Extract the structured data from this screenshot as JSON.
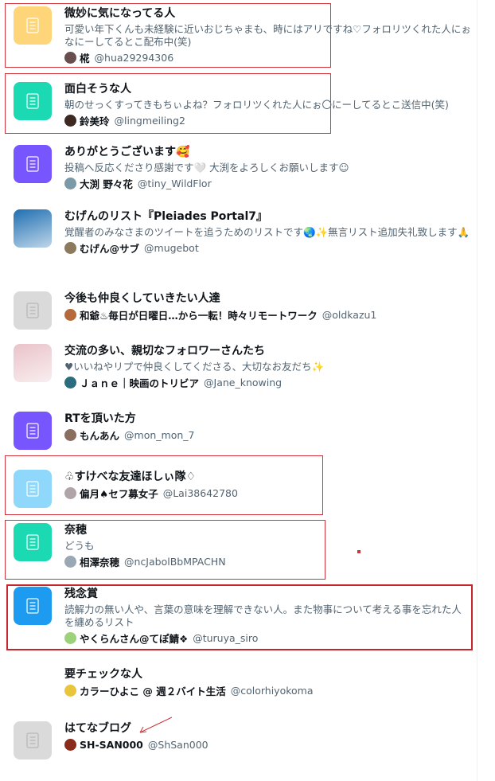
{
  "lists": [
    {
      "title": "微妙に気になってる人",
      "description": "可愛い年下くんも未経験に近いおじちゃまも、時にはアリですね♡フォロリツくれた人にぉなにーしてるとこ配布中(笑)",
      "owner_name": "椛",
      "owner_handle": "@hua29294306",
      "thumb_color": "#ffd57a",
      "avatar_color": "#6a4e4e",
      "icon": "document-icon"
    },
    {
      "title": "面白そうな人",
      "description": "朝のせっくすってきもちぃよね？フォロリツくれた人にぉ〇にーしてるとこ送信中(笑)",
      "owner_name": "鈴美玲",
      "owner_handle": "@lingmeiling2",
      "thumb_color": "#1ad9b3",
      "avatar_color": "#3c2a22",
      "icon": "document-icon"
    },
    {
      "title": "ありがとうございます🥰",
      "description": "投稿へ反応くださり感謝です🤍 大渕をよろしくお願いします☺",
      "owner_name": "大渕 野々花",
      "owner_handle": "@tiny_WildFlor",
      "thumb_color": "#7856ff",
      "avatar_color": "#7a9aa8",
      "icon": "document-icon"
    },
    {
      "title": "むげんのリスト『Pleiades Portal7』",
      "description": "覚醒者のみなさまのツイートを追うためのリストです🌏✨無言リスト追加失礼致します🙏",
      "owner_name": "むげん@サブ",
      "owner_handle": "@mugebot",
      "thumb_color": "#1f6fb2",
      "avatar_color": "#8c7a5c",
      "icon": "image-thumbnail"
    },
    {
      "title": "今後も仲良くしていきたい人達",
      "description": "",
      "owner_name": "和爺♨毎日が日曜日…から一転！時々リモートワーク",
      "owner_handle": "@oldkazu1",
      "thumb_color": "#dadada",
      "avatar_color": "#b56a3c",
      "icon": "document-icon"
    },
    {
      "title": "交流の多い、親切なフォロワーさんたち",
      "description": "♥いいねやリプで仲良くしてくださる、大切なお友だち✨",
      "owner_name": "Ｊａｎｅ｜映画のトリビア",
      "owner_handle": "@Jane_knowing",
      "thumb_color": "#e9c3c9",
      "avatar_color": "#2b6c7e",
      "icon": "image-thumbnail"
    },
    {
      "title": "RTを頂いた方",
      "description": "",
      "owner_name": "もんあん",
      "owner_handle": "@mon_mon_7",
      "thumb_color": "#7856ff",
      "avatar_color": "#8a6e5e",
      "icon": "document-icon"
    },
    {
      "title": "♧すけべな友達ほしぃ隊♢",
      "description": "",
      "owner_name": "偏月♠セフ募女子",
      "owner_handle": "@Lai38642780",
      "thumb_color": "#8fd8fb",
      "avatar_color": "#b0a4a8",
      "icon": "document-icon"
    },
    {
      "title": "奈穂",
      "description": "どうも",
      "owner_name": "相澤奈穂",
      "owner_handle": "@ncJabolBbMPACHN",
      "thumb_color": "#1ad9b3",
      "avatar_color": "#9aa7b4",
      "icon": "document-icon"
    },
    {
      "title": "残念賞",
      "description": "読解力の無い人や、言葉の意味を理解できない人。また物事について考える事を忘れた人を纏めるリスト",
      "owner_name": "やくらんさん@てぽ鯖❖",
      "owner_handle": "@turuya_siro",
      "thumb_color": "#1d9bf0",
      "avatar_color": "#9ed27a",
      "icon": "document-icon"
    },
    {
      "title": "要チェックな人",
      "description": "",
      "owner_name": "カラーひよこ @ 週２バイト生活",
      "owner_handle": "@colorhiyokoma",
      "thumb_color": "#ffffff",
      "avatar_color": "#e8c53a",
      "icon": "image-thumbnail"
    },
    {
      "title": "はてなブログ",
      "description": "",
      "owner_name": "SH-SAN000",
      "owner_handle": "@ShSan000",
      "thumb_color": "#dadada",
      "avatar_color": "#8b2b1a",
      "icon": "document-icon"
    }
  ],
  "annotation_color": "#d0343a"
}
